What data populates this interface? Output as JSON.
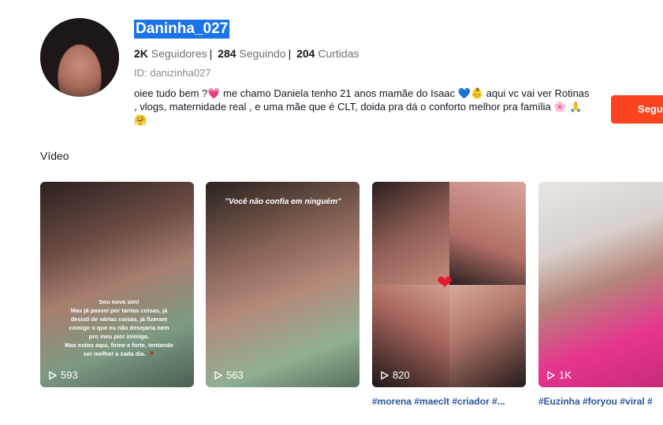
{
  "profile": {
    "username": "Daninha_027",
    "followers_count": "2K",
    "followers_label": "Seguidores",
    "following_count": "284",
    "following_label": "Seguindo",
    "likes_count": "204",
    "likes_label": "Curtidas",
    "id_text": "ID: danizinha027",
    "bio": "oiee tudo bem ?💗 me chamo Daniela tenho 21 anos mamãe do Isaac 💙👶 aqui vc vai ver Rotinas , vlogs, maternidade real , e uma mãe que é CLT, doida pra dá o conforto melhor pra família 🌸 🙏 🤗",
    "follow_label": "Seguir"
  },
  "section": {
    "title": "Vídeo"
  },
  "videos": [
    {
      "views": "593",
      "overlay": "Sou nova sim!\nMas já passei por tantas coisas, já desisti de várias coisas, já fizeram comigo o que eu não desejaria nem pro meu pior inimigo.\nMas estou aqui, firme e forte, tentando ser melhor a cada dia. 🥀",
      "caption": ""
    },
    {
      "views": "563",
      "overlay": "\"Você não confia em ninguém\"",
      "caption": ""
    },
    {
      "views": "820",
      "overlay": "",
      "caption": "#morena #maeclt #criador #..."
    },
    {
      "views": "1K",
      "overlay": "",
      "caption": "#Euzinha #foryou #viral #"
    }
  ],
  "colors": {
    "follow_button": "#f9441f",
    "highlight": "#1a73e8",
    "hashtag": "#2b5597"
  }
}
